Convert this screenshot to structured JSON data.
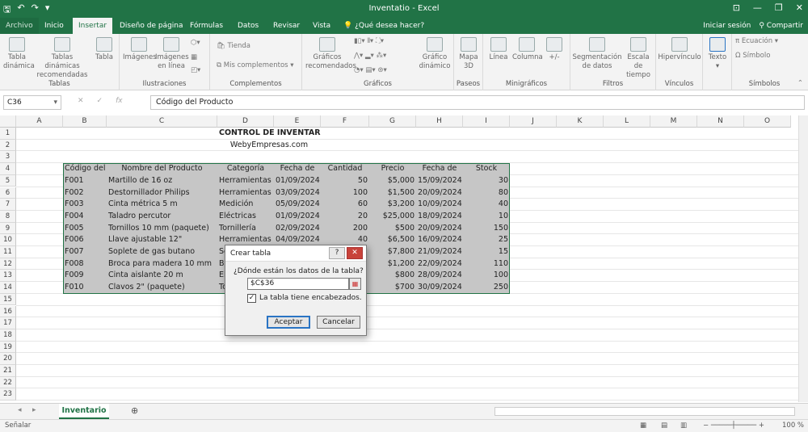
{
  "window": {
    "title": "Inventatio - Excel"
  },
  "ribbon_tabs": [
    "Archivo",
    "Inicio",
    "Insertar",
    "Diseño de página",
    "Fórmulas",
    "Datos",
    "Revisar",
    "Vista"
  ],
  "active_tab": "Insertar",
  "tell_me": "¿Qué desea hacer?",
  "sign_in": "Iniciar sesión",
  "share": "Compartir",
  "ribbon": {
    "tablas": {
      "label": "Tablas",
      "btn1": "Tabla dinámica",
      "btn2": "Tablas dinámicas recomendadas",
      "btn3": "Tabla"
    },
    "ilustraciones": {
      "label": "Ilustraciones",
      "btn1": "Imágenes",
      "btn2": "Imágenes en línea"
    },
    "complementos": {
      "label": "Complementos",
      "tienda": "Tienda",
      "mis": "Mis complementos"
    },
    "graficos": {
      "label": "Gráficos",
      "rec": "Gráficos recomendados",
      "din": "Gráfico dinámico"
    },
    "paseos": {
      "label": "Paseos",
      "mapa": "Mapa 3D"
    },
    "minigraficos": {
      "label": "Minigráficos",
      "linea": "Línea",
      "columna": "Columna",
      "gp": "+/-"
    },
    "filtros": {
      "label": "Filtros",
      "seg": "Segmentación de datos",
      "escala": "Escala de tiempo"
    },
    "vinculos": {
      "label": "Vínculos",
      "hiper": "Hipervínculo"
    },
    "texto": {
      "label": "Texto"
    },
    "simbolos": {
      "label": "Símbolos",
      "ecuacion": "Ecuación",
      "simbolo": "Símbolo"
    }
  },
  "formula_bar": {
    "name_box": "C36",
    "content": "Código del Producto"
  },
  "columns": [
    "A",
    "B",
    "C",
    "D",
    "E",
    "F",
    "G",
    "H",
    "I",
    "J",
    "K",
    "L",
    "M",
    "N",
    "O"
  ],
  "rows": [
    "1",
    "2",
    "3",
    "4",
    "5",
    "6",
    "7",
    "8",
    "9",
    "10",
    "11",
    "12",
    "13",
    "14",
    "15",
    "16",
    "17",
    "18",
    "19",
    "20",
    "21",
    "22",
    "23"
  ],
  "sheet": {
    "title": "CONTROL DE INVENTARIO",
    "subtitle": "WebyEmpresas.com",
    "headers": [
      "Código del",
      "Nombre del Producto",
      "Categoría",
      "Fecha de",
      "Cantidad",
      "Precio",
      "Fecha de",
      "Stock"
    ],
    "data": [
      [
        "F001",
        "Martillo de 16 oz",
        "Herramientas",
        "01/09/2024",
        "50",
        "$5,000",
        "15/09/2024",
        "30"
      ],
      [
        "F002",
        "Destornillador Philips",
        "Herramientas",
        "03/09/2024",
        "100",
        "$1,500",
        "20/09/2024",
        "80"
      ],
      [
        "F003",
        "Cinta métrica 5 m",
        "Medición",
        "05/09/2024",
        "60",
        "$3,200",
        "10/09/2024",
        "40"
      ],
      [
        "F004",
        "Taladro percutor",
        "Eléctricas",
        "01/09/2024",
        "20",
        "$25,000",
        "18/09/2024",
        "10"
      ],
      [
        "F005",
        "Tornillos 10 mm (paquete)",
        "Tornillería",
        "02/09/2024",
        "200",
        "$500",
        "20/09/2024",
        "150"
      ],
      [
        "F006",
        "Llave ajustable 12\"",
        "Herramientas",
        "04/09/2024",
        "40",
        "$6,500",
        "16/09/2024",
        "25"
      ],
      [
        "F007",
        "Soplete de gas butano",
        "So",
        "",
        "",
        "$7,800",
        "21/09/2024",
        "15"
      ],
      [
        "F008",
        "Broca para madera 10 mm",
        "Br",
        "",
        "",
        "$1,200",
        "22/09/2024",
        "110"
      ],
      [
        "F009",
        "Cinta aislante 20 m",
        "El",
        "",
        "",
        "$800",
        "28/09/2024",
        "100"
      ],
      [
        "F010",
        "Clavos 2\" (paquete)",
        "To",
        "",
        "",
        "$700",
        "30/09/2024",
        "250"
      ]
    ]
  },
  "dialog": {
    "title": "Crear tabla",
    "question": "¿Dónde están los datos de la tabla?",
    "range": "$C$36",
    "checkbox_label": "La tabla tiene encabezados.",
    "ok": "Aceptar",
    "cancel": "Cancelar"
  },
  "sheet_tab": "Inventario",
  "status": {
    "mode": "Señalar",
    "zoom": "100 %"
  },
  "colors": {
    "accent": "#217346",
    "selection": "#c6c6c6"
  }
}
